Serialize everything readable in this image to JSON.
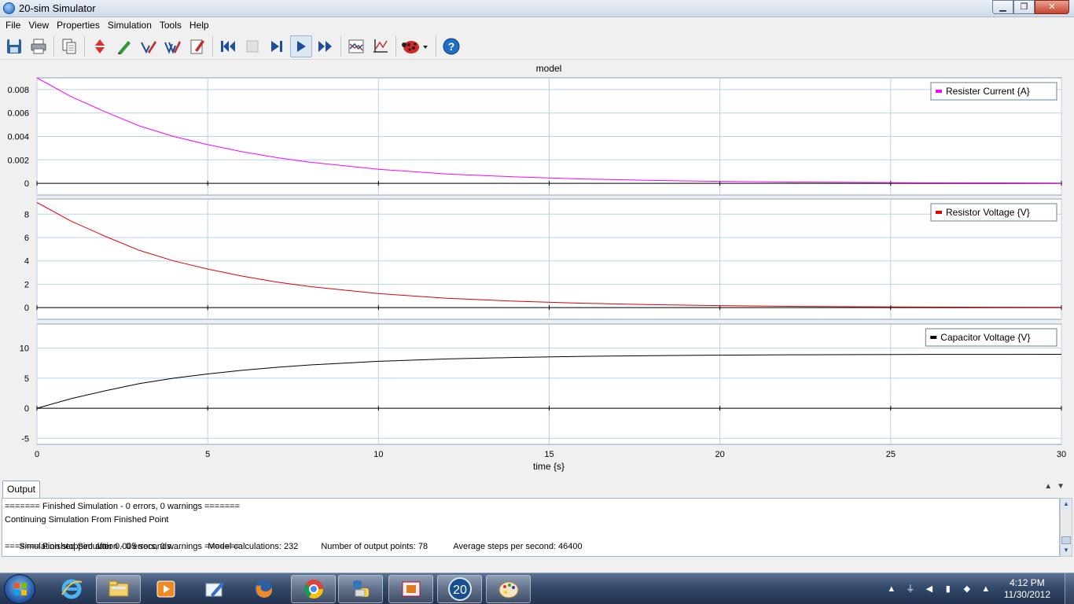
{
  "window": {
    "title": "20-sim Simulator",
    "min_label": "▁",
    "max_label": "❐",
    "close_label": "✕"
  },
  "menu": [
    {
      "label": "File"
    },
    {
      "label": "View"
    },
    {
      "label": "Properties"
    },
    {
      "label": "Simulation"
    },
    {
      "label": "Tools"
    },
    {
      "label": "Help"
    }
  ],
  "toolbar": {
    "icons": [
      "save-icon",
      "print-icon",
      "copy-icon",
      "properties-icon",
      "parameters-icon",
      "multiple-run-icon",
      "export-icon",
      "edit-plot-icon",
      "rewind-icon",
      "stop-icon",
      "step-icon",
      "run-icon",
      "fast-forward-icon",
      "plot-properties-icon",
      "axis-icon",
      "debug-ladybug-icon",
      "help-icon"
    ]
  },
  "plot": {
    "title": "model",
    "xlabel": "time {s}"
  },
  "chart_data": [
    {
      "type": "line",
      "legend_position": "top-right",
      "grid": true,
      "xlim": [
        0,
        30
      ],
      "ylim": [
        -0.001,
        0.009
      ],
      "yticks": [
        "0.008",
        "0.006",
        "0.004",
        "0.002",
        "0"
      ],
      "ytick_values": [
        0.008,
        0.006,
        0.004,
        0.002,
        0
      ],
      "series": [
        {
          "name": "Resister Current {A}",
          "color": "#ff00ff",
          "x": [
            0,
            1,
            2,
            3,
            4,
            5,
            6,
            7,
            8,
            9,
            10,
            12,
            14,
            16,
            18,
            20,
            22,
            24,
            26,
            28,
            30
          ],
          "values": [
            0.009,
            0.0074,
            0.0061,
            0.0049,
            0.004,
            0.0033,
            0.0027,
            0.0022,
            0.0018,
            0.0015,
            0.0012,
            0.0008,
            0.00055,
            0.00037,
            0.00025,
            0.00017,
            0.00011,
            8e-05,
            5e-05,
            4e-05,
            3e-05
          ]
        }
      ]
    },
    {
      "type": "line",
      "legend_position": "top-right",
      "grid": true,
      "xlim": [
        0,
        30
      ],
      "ylim": [
        -1,
        9.3
      ],
      "yticks": [
        "8",
        "6",
        "4",
        "2",
        "0"
      ],
      "ytick_values": [
        8,
        6,
        4,
        2,
        0
      ],
      "series": [
        {
          "name": "Resistor Voltage {V}",
          "color": "#e00000",
          "x": [
            0,
            1,
            2,
            3,
            4,
            5,
            6,
            7,
            8,
            9,
            10,
            12,
            14,
            16,
            18,
            20,
            22,
            24,
            26,
            28,
            30
          ],
          "values": [
            9.0,
            7.4,
            6.1,
            4.9,
            4.0,
            3.3,
            2.7,
            2.2,
            1.8,
            1.5,
            1.2,
            0.8,
            0.55,
            0.37,
            0.25,
            0.17,
            0.11,
            0.08,
            0.05,
            0.04,
            0.03
          ]
        }
      ]
    },
    {
      "type": "line",
      "legend_position": "top-right",
      "grid": true,
      "xlim": [
        0,
        30
      ],
      "ylim": [
        -6,
        14
      ],
      "yticks": [
        "10",
        "5",
        "0",
        "-5"
      ],
      "ytick_values": [
        10,
        5,
        0,
        -5
      ],
      "xticks": [
        "0",
        "5",
        "10",
        "15",
        "20",
        "25",
        "30"
      ],
      "xtick_values": [
        0,
        5,
        10,
        15,
        20,
        25,
        30
      ],
      "series": [
        {
          "name": "Capacitor Voltage {V}",
          "color": "#000000",
          "x": [
            0,
            1,
            2,
            3,
            4,
            5,
            6,
            7,
            8,
            9,
            10,
            12,
            14,
            16,
            18,
            20,
            22,
            24,
            26,
            28,
            30
          ],
          "values": [
            0,
            1.6,
            2.9,
            4.1,
            5.0,
            5.7,
            6.3,
            6.8,
            7.2,
            7.5,
            7.8,
            8.2,
            8.45,
            8.63,
            8.75,
            8.83,
            8.89,
            8.92,
            8.95,
            8.96,
            8.97
          ]
        }
      ]
    }
  ],
  "output": {
    "tab_label": "Output",
    "lines": [
      {
        "text": "======= Finished Simulation - 0 errors, 0 warnings ======="
      },
      {
        "text": "Continuing Simulation From Finished Point"
      },
      {
        "parts": [
          "Simulation stopped after 0.005 seconds.",
          "Model calculations: 232",
          "Number of output points: 78",
          "Average steps per second: 46400"
        ]
      },
      {
        "text": "======= Finished Simulation - 0 errors, 0 warnings ======="
      }
    ]
  },
  "taskbar": {
    "apps": [
      "internet-explorer-icon",
      "file-explorer-icon",
      "media-player-icon",
      "paint-app-icon",
      "firefox-icon",
      "chrome-icon",
      "python-icon",
      "office-icon",
      "20-sim-icon",
      "paint-palette-icon"
    ],
    "sim_label": "20",
    "clock_time": "4:12 PM",
    "clock_date": "11/30/2012"
  }
}
